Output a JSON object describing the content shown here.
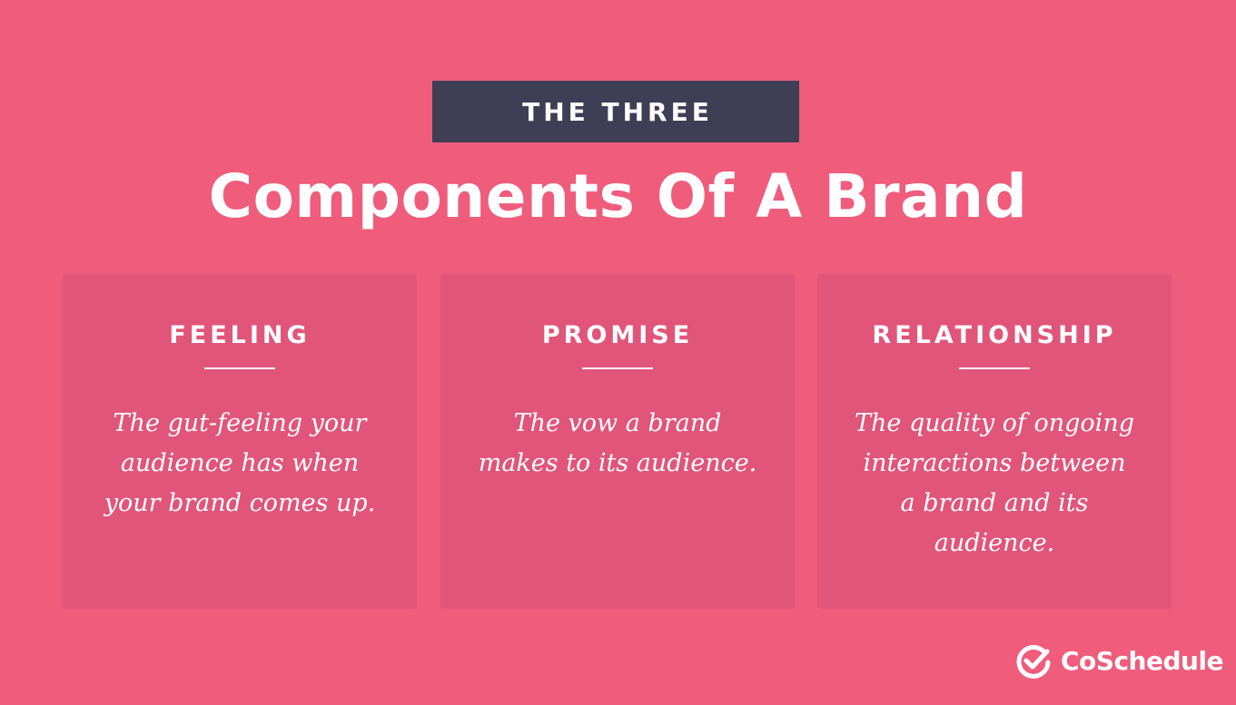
{
  "header": {
    "kicker": "THE THREE",
    "title": "Components Of A Brand"
  },
  "cards": [
    {
      "title": "FEELING",
      "description": "The gut-feeling your audience has when your brand comes up."
    },
    {
      "title": "PROMISE",
      "description": "The vow a brand makes to its audience."
    },
    {
      "title": "RELATIONSHIP",
      "description": "The quality of ongoing interactions between a brand and its audience."
    }
  ],
  "brand": {
    "name": "CoSchedule",
    "logo_icon": "checkmark-circle-icon"
  },
  "colors": {
    "background": "#f05c7c",
    "card": "#e1557a",
    "banner": "#3e3f55",
    "text": "#ffffff"
  }
}
